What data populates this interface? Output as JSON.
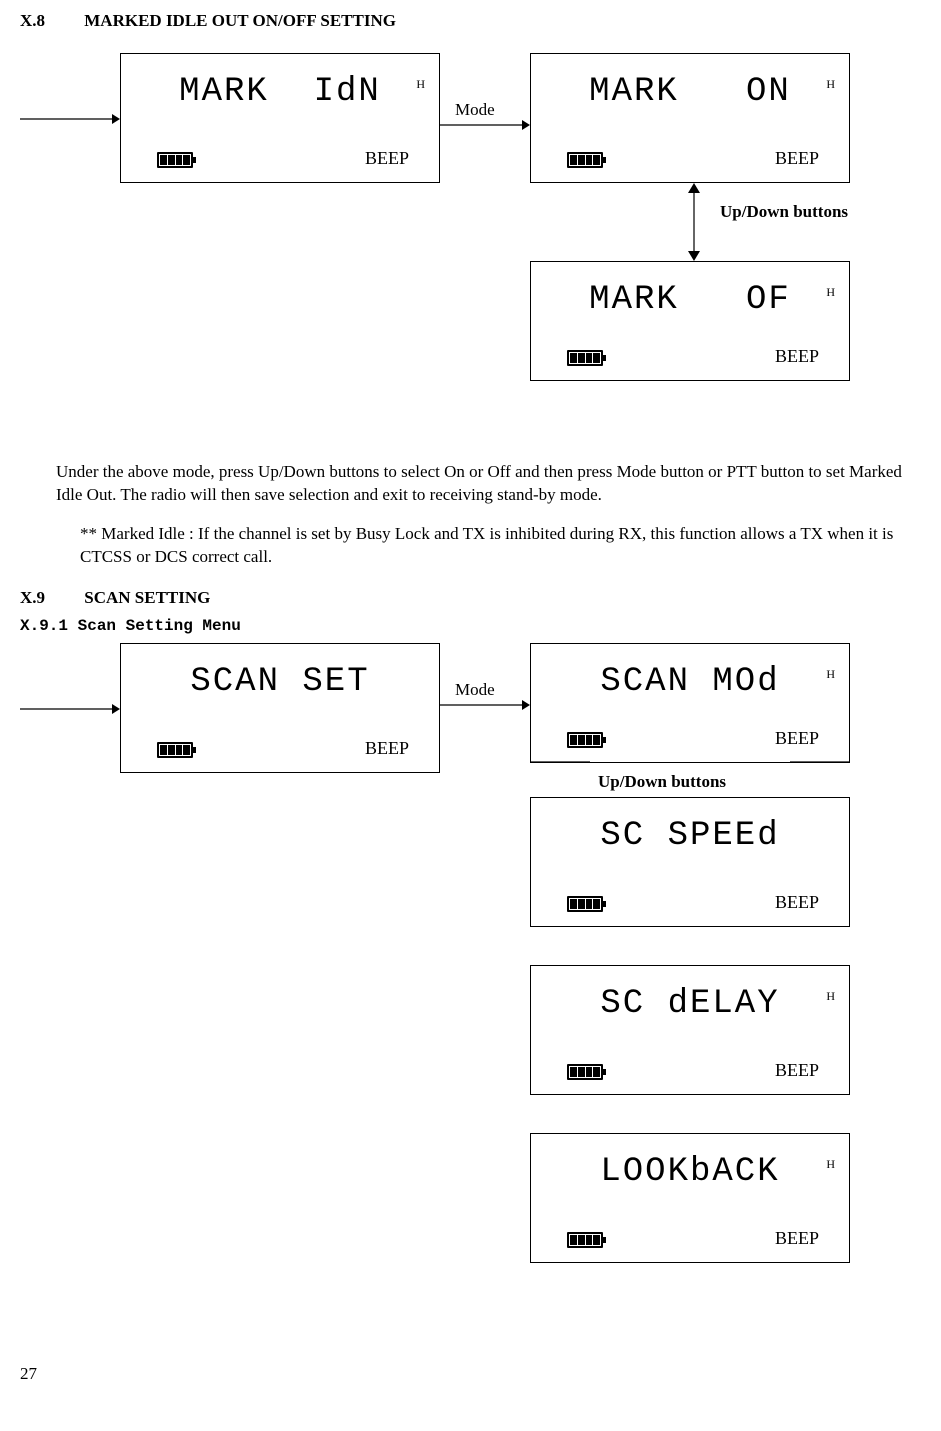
{
  "sectionA": {
    "num": "X.8",
    "title": "MARKED IDLE OUT ON/OFF SETTING",
    "modeLabel": "Mode",
    "updownLabel": "Up/Down buttons",
    "screens": {
      "markIdn": {
        "text": "MARK  IdN",
        "h": "H",
        "beep": "BEEP"
      },
      "markOn": {
        "text": "MARK   ON",
        "h": "H",
        "beep": "BEEP"
      },
      "markOf": {
        "text": "MARK   OF",
        "h": "H",
        "beep": "BEEP"
      }
    },
    "paragraph": "Under the above mode, press Up/Down buttons to select On or Off and then press Mode button or PTT button to set Marked Idle Out. The radio will then save selection and exit to receiving stand-by mode.",
    "note": "** Marked Idle : If the channel is set by Busy Lock and TX is inhibited during RX, this function allows a TX when it is CTCSS or DCS correct call."
  },
  "sectionB": {
    "num": "X.9",
    "title": "SCAN SETTING",
    "sub": "X.9.1 Scan Setting Menu",
    "modeLabel": "Mode",
    "updownLabel": "Up/Down buttons",
    "screens": {
      "scanSet": {
        "text": "SCAN SET",
        "h": "",
        "beep": "BEEP"
      },
      "scanMod": {
        "text": "SCAN MOd",
        "h": "H",
        "beep": "BEEP"
      },
      "scSpeed": {
        "text": "SC SPEEd",
        "h": "",
        "beep": "BEEP"
      },
      "scDelay": {
        "text": "SC dELAY",
        "h": "H",
        "beep": "BEEP"
      },
      "lookback": {
        "text": "LOOKbACK",
        "h": "H",
        "beep": "BEEP"
      }
    }
  },
  "pageNumber": "27"
}
